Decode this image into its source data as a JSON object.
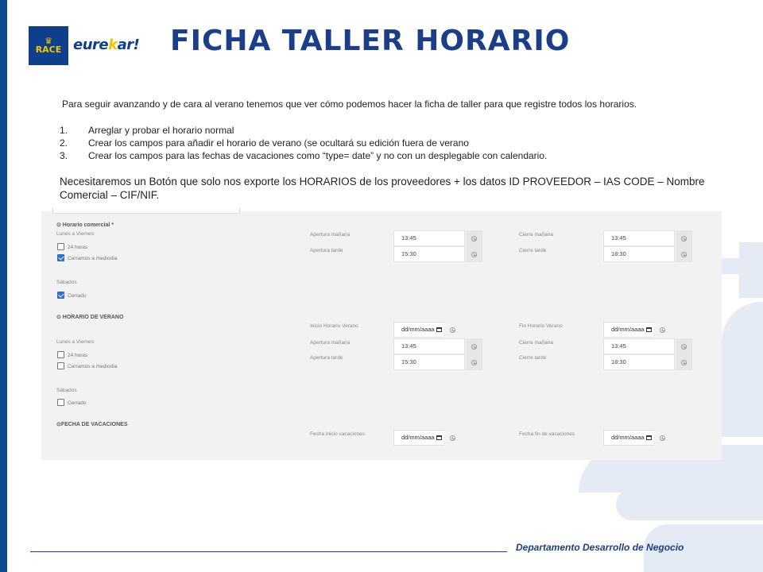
{
  "logos": {
    "race": "RACE",
    "eurekar_a": "eure",
    "eurekar_b": "k",
    "eurekar_c": "ar!"
  },
  "title": "FICHA TALLER HORARIO",
  "intro": "Para seguir avanzando y de cara al verano tenemos que ver cómo podemos hacer la ficha de taller para que registre todos los horarios.",
  "steps": [
    {
      "num": "1.",
      "text": "Arreglar y probar el horario normal"
    },
    {
      "num": "2.",
      "text": "Crear los campos para añadir el horario de verano (se ocultará su edición fuera de verano"
    },
    {
      "num": "3.",
      "text": "Crear los campos para las fechas de vacaciones como “type= date” y no con un desplegable con calendario."
    }
  ],
  "note": "Necesitaremos un Botón que solo nos exporte los HORARIOS de los proveedores + los datos ID PROVEEDOR – IAS CODE – Nombre Comercial – CIF/NIF.",
  "form": {
    "horario": {
      "title": "⊙ Horario comercial *",
      "lv": "Lunes a Viernes",
      "cb24": "24 horas",
      "cbMed": "Cerramos a mediodía",
      "am_label": "Apertura mañana",
      "am_value": "13:45",
      "at_label": "Apertura tarde",
      "at_value": "15:30",
      "cm_label": "Cierre mañana",
      "cm_value": "13:45",
      "ct_label": "Cierre tarde",
      "ct_value": "18:30",
      "sab": "Sábados",
      "cerrado": "Cerrado"
    },
    "verano": {
      "title": "⊙ HORARIO DE VERANO",
      "inicio_label": "Inicio Horario Verano",
      "fin_label": "Fin Horario Verano",
      "date_placeholder": "dd/mm/aaaa",
      "lv": "Lunes a Viernes",
      "cb24": "24 horas",
      "cbMed": "Cerramos a mediodía",
      "am_label": "Apertura mañana",
      "am_value": "13:45",
      "at_label": "Apertura tarde",
      "at_value": "15:30",
      "cm_label": "Cierre mañana",
      "cm_value": "13:45",
      "ct_label": "Cierre tarde",
      "ct_value": "18:30",
      "sab": "Sábados",
      "cerrado": "Cerrado"
    },
    "vacaciones": {
      "title": "⊙FECHA DE VACACIONES",
      "inicio_label": "Fecha inicio vacaciones",
      "fin_label": "Fecha fin de vacaciones",
      "date_placeholder": "dd/mm/aaaa"
    }
  },
  "footer": "Departamento Desarrollo de Negocio"
}
